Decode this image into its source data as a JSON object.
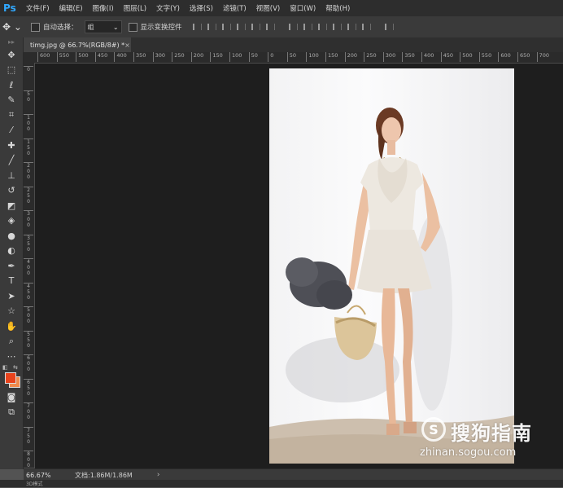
{
  "app": {
    "logo": "Ps"
  },
  "menu": [
    "文件(F)",
    "编辑(E)",
    "图像(I)",
    "图层(L)",
    "文字(Y)",
    "选择(S)",
    "滤镜(T)",
    "视图(V)",
    "窗口(W)",
    "帮助(H)"
  ],
  "options": {
    "auto_select_label": "自动选择：",
    "auto_select_value": "组",
    "show_transform_label": "显示变换控件"
  },
  "document": {
    "tab_title": "timg.jpg @ 66.7%(RGB/8#) *",
    "close": "×"
  },
  "ruler_h": [
    "600",
    "550",
    "500",
    "450",
    "400",
    "350",
    "300",
    "250",
    "200",
    "150",
    "100",
    "50",
    "0",
    "50",
    "100",
    "150",
    "200",
    "250",
    "300",
    "350",
    "400",
    "450",
    "500",
    "550",
    "600",
    "650",
    "700"
  ],
  "ruler_v": [
    "0",
    "50",
    "100",
    "150",
    "200",
    "250",
    "300",
    "350",
    "400",
    "450",
    "500",
    "550",
    "600",
    "650",
    "700",
    "750",
    "800"
  ],
  "status": {
    "zoom": "66.67%",
    "doc": "文档:1.86M/1.86M",
    "arrow": "›"
  },
  "colors": {
    "foreground": "#e8431c",
    "background": "#f08a4b",
    "accent": "#31a8ff"
  },
  "watermark": {
    "brand": "搜狗指南",
    "url": "zhinan.sogou.com"
  },
  "bottom": {
    "label": "3D模式"
  }
}
